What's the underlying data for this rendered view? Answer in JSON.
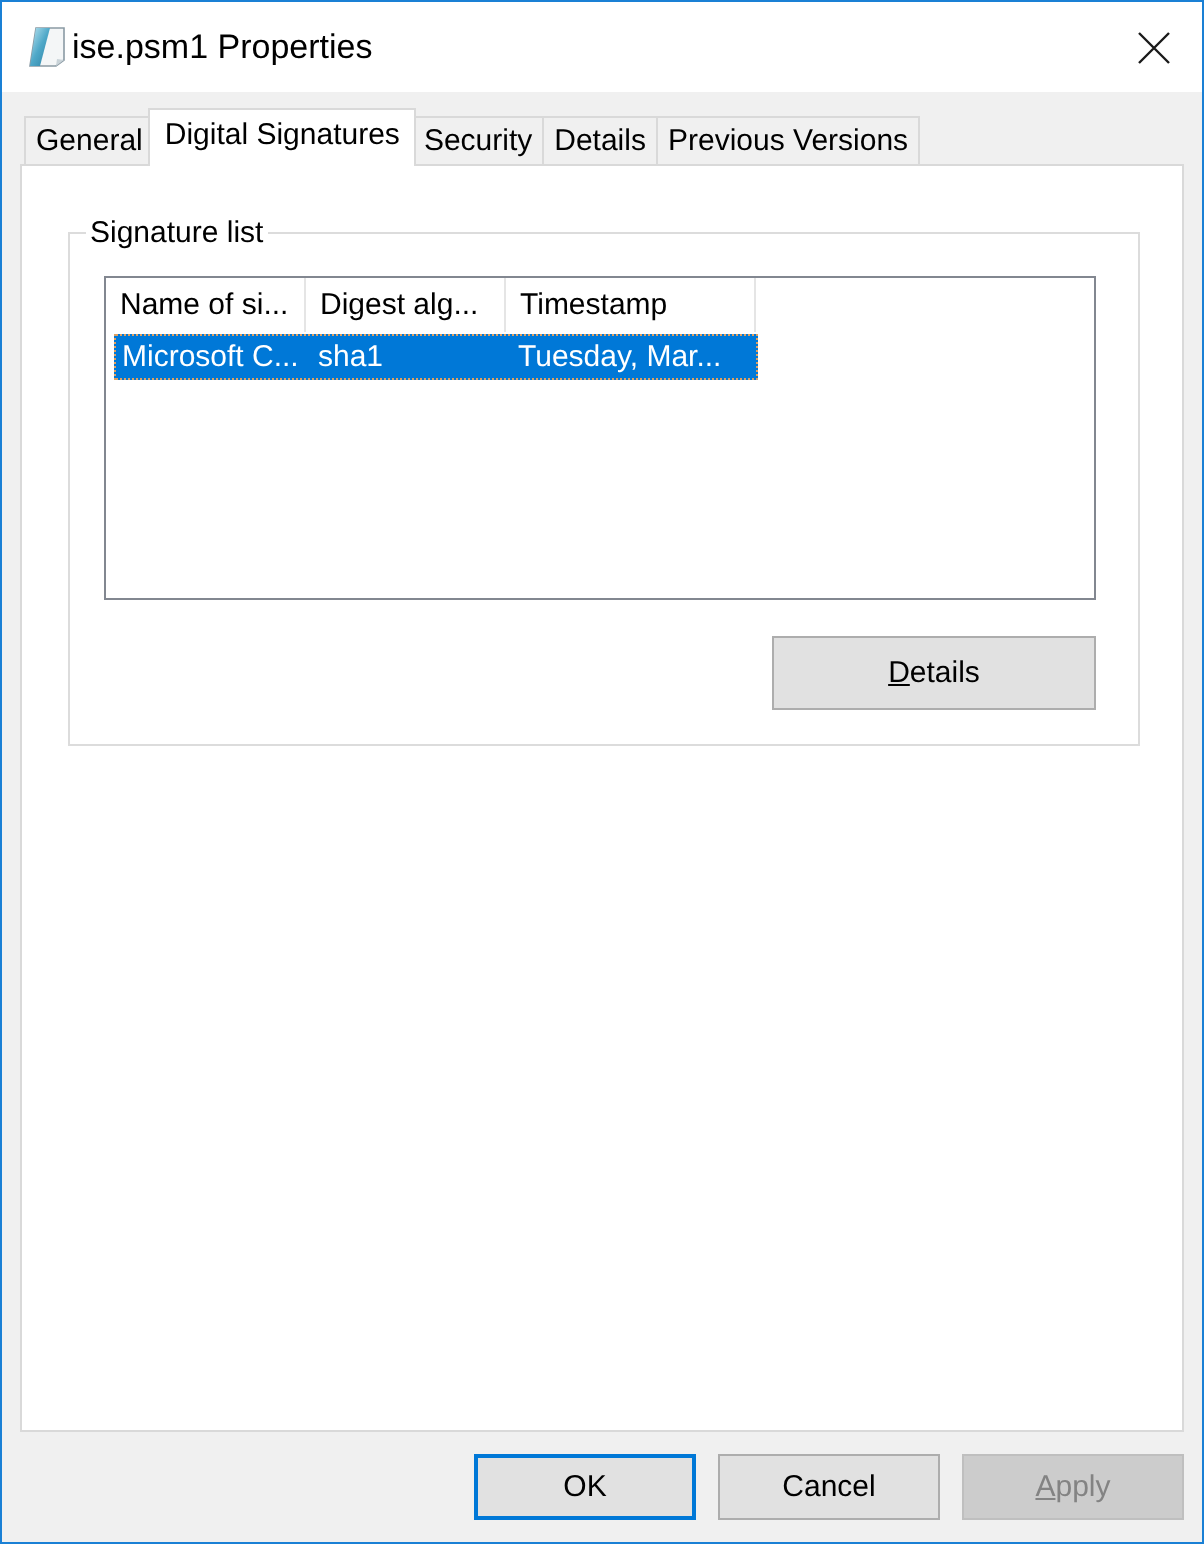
{
  "window": {
    "title": "ise.psm1 Properties"
  },
  "tabs": [
    {
      "label": "General",
      "selected": false
    },
    {
      "label": "Digital Signatures",
      "selected": true
    },
    {
      "label": "Security",
      "selected": false
    },
    {
      "label": "Details",
      "selected": false
    },
    {
      "label": "Previous Versions",
      "selected": false
    }
  ],
  "signature_list": {
    "title": "Signature list",
    "columns": [
      "Name of si...",
      "Digest alg...",
      "Timestamp"
    ],
    "rows": [
      {
        "cells": [
          "Microsoft C...",
          "sha1",
          "Tuesday, Mar..."
        ],
        "selected": true
      }
    ]
  },
  "details_button": {
    "label": "Details",
    "access_key": true
  },
  "buttons": [
    {
      "label": "OK",
      "kind": "default",
      "disabled": false,
      "access_key": false
    },
    {
      "label": "Cancel",
      "kind": "normal",
      "disabled": false,
      "access_key": false
    },
    {
      "label": "Apply",
      "kind": "normal",
      "disabled": true,
      "access_key": true
    }
  ]
}
